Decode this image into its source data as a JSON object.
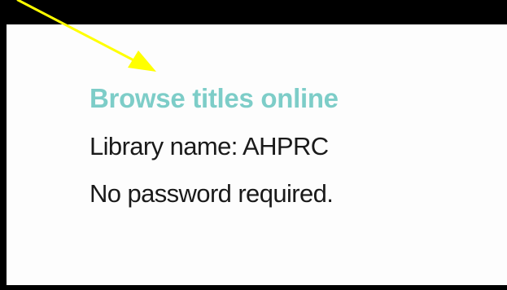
{
  "content": {
    "link_label": "Browse titles online",
    "library_line": "Library name: AHPRC",
    "password_line": "No password required."
  },
  "colors": {
    "background": "#000000",
    "panel": "#fdfdfd",
    "link": "#7dcdc8",
    "body_text": "#1a1a1a",
    "arrow": "#ffff00"
  },
  "annotation": {
    "icon": "arrow-icon"
  }
}
